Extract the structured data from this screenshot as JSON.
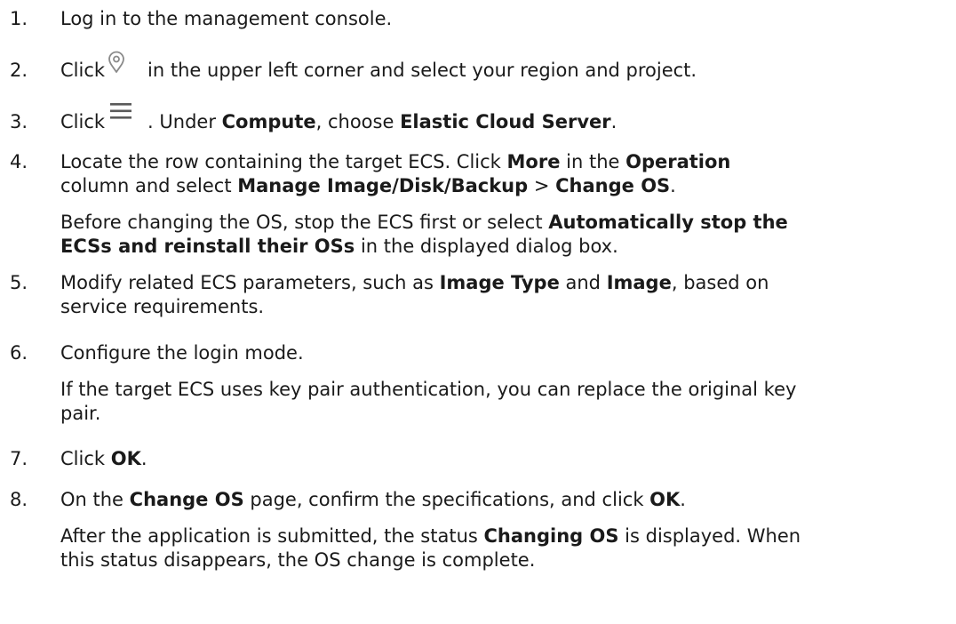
{
  "steps": [
    {
      "number": "1.",
      "text": "Log in to the management console."
    },
    {
      "number": "2.",
      "before_icon": "Click",
      "icon": "location-pin-icon",
      "after_icon": "in the upper left corner and select your region and project."
    },
    {
      "number": "3.",
      "before_icon": "Click",
      "icon": "hamburger-menu-icon",
      "t1": ". Under ",
      "b1": "Compute",
      "t2": ", choose ",
      "b2": "Elastic Cloud Server",
      "t3": "."
    },
    {
      "number": "4.",
      "line1": {
        "t1": "Locate the row containing the target ECS. Click ",
        "b1": "More",
        "t2": " in the ",
        "b2": "Operation"
      },
      "line2": {
        "t1": "column and select ",
        "b1": "Manage Image/Disk/Backup",
        "t2": " > ",
        "b2": "Change OS",
        "t3": "."
      },
      "note_line1": {
        "t1": "Before changing the OS, stop the ECS first or select ",
        "b1": "Automatically stop the"
      },
      "note_line2": {
        "b1": "ECSs and reinstall their OSs",
        "t1": " in the displayed dialog box."
      }
    },
    {
      "number": "5.",
      "line1": {
        "t1": "Modify related ECS parameters, such as ",
        "b1": "Image Type",
        "t2": " and ",
        "b2": "Image",
        "t3": ", based on"
      },
      "line2": "service requirements."
    },
    {
      "number": "6.",
      "text": "Configure the login mode.",
      "note_line1": "If the target ECS uses key pair authentication, you can replace the original key",
      "note_line2": "pair."
    },
    {
      "number": "7.",
      "t1": "Click ",
      "b1": "OK",
      "t2": "."
    },
    {
      "number": "8.",
      "t1": "On the ",
      "b1": "Change OS",
      "t2": " page, confirm the specifications, and click ",
      "b2": "OK",
      "t3": ".",
      "note_line1": {
        "t1": "After the application is submitted, the status ",
        "b1": "Changing OS",
        "t2": " is displayed. When"
      },
      "note_line2": "this status disappears, the OS change is complete."
    }
  ],
  "colors": {
    "text": "#1a1a1a",
    "icon": "#8a8a8a"
  }
}
